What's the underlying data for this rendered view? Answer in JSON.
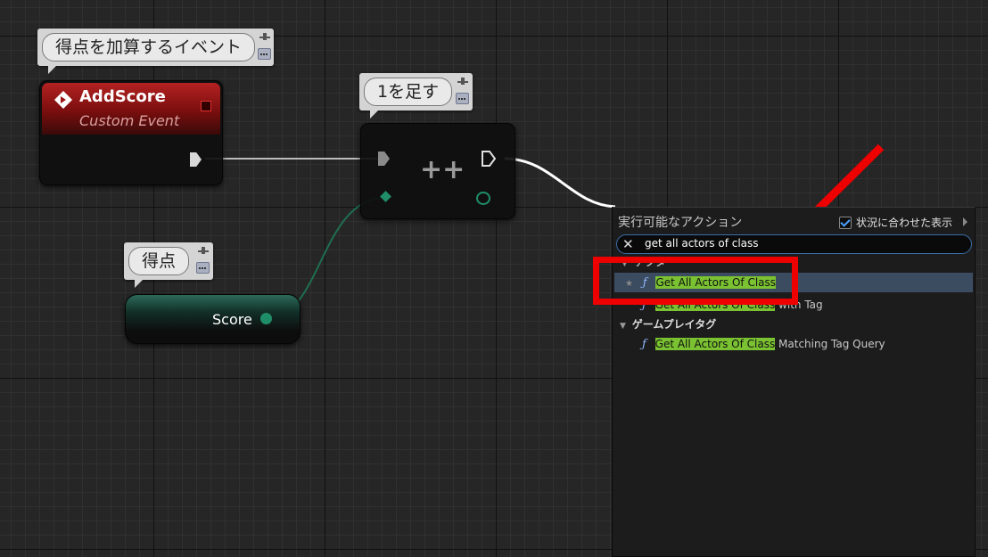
{
  "comments": {
    "event": "得点を加算するイベント",
    "increment": "1を足す",
    "score": "得点"
  },
  "nodes": {
    "custom_event": {
      "title": "AddScore",
      "subtitle": "Custom Event"
    },
    "increment": {
      "symbol": "++"
    },
    "score_var": {
      "label": "Score"
    }
  },
  "action_menu": {
    "title": "実行可能なアクション",
    "context_sensitive_label": "状況に合わせた表示",
    "context_sensitive_checked": true,
    "search_value": "get all actors of class",
    "category_1": "アクタ",
    "category_2": "ゲームプレイタグ",
    "results": [
      {
        "match": "Get All Actors Of Class",
        "suffix": ""
      },
      {
        "match": "Get All Actors Of Class",
        "suffix": " with Tag"
      },
      {
        "match": "Get All Actors Of Class",
        "suffix": " Matching Tag Query"
      }
    ]
  },
  "colors": {
    "annotation": "#ee0000",
    "match_highlight": "#7ac231",
    "event_header": "#b42222"
  }
}
